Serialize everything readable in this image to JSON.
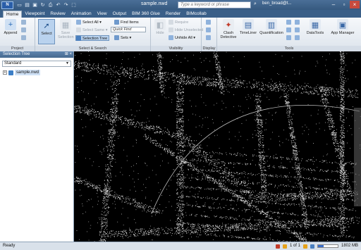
{
  "titlebar": {
    "app_button": "N",
    "doc_title": "sample.nwd",
    "search_placeholder": "Type a keyword or phrase",
    "user": "ben_broad@t..."
  },
  "tabs": [
    "Home",
    "Viewpoint",
    "Review",
    "Animation",
    "View",
    "Output",
    "BIM 360 Glue",
    "Render",
    "BIMcollab"
  ],
  "ribbon": {
    "project": {
      "append": "Append",
      "label": "Project"
    },
    "select": {
      "select_btn": "Select",
      "save_selection": "Save Selection",
      "select_all": "Select All",
      "select_same": "Select Same",
      "selection_tree": "Selection Tree",
      "find_items": "Find Items",
      "quick_find": "Quick Find",
      "sets": "Sets",
      "label": "Select & Search"
    },
    "visibility": {
      "hide": "Hide",
      "require": "Require",
      "hide_unselected": "Hide Unselected",
      "unhide_all": "Unhide All",
      "label": "Visibility"
    },
    "display": {
      "label": "Display"
    },
    "tools": {
      "clash": "Clash Detective",
      "timeliner": "TimeLiner",
      "quantification": "Quantification",
      "datatools": "DataTools",
      "app_manager": "App Manager",
      "label": "Tools"
    }
  },
  "panel": {
    "title": "Selection Tree",
    "dropdown": "Standard",
    "item": "sample.nwd"
  },
  "status": {
    "ready": "Ready",
    "memory": "1802 MB",
    "page": "1 of 1"
  },
  "colors": {
    "accent": "#3a5f88",
    "viewport_bg": "#000000"
  }
}
